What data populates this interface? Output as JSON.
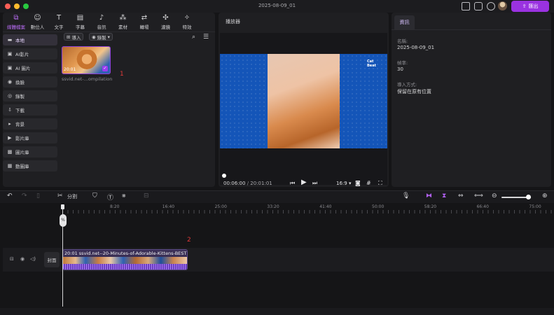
{
  "window": {
    "document_title": "2025-08-09_01",
    "export_label": "匯出"
  },
  "toolbar": {
    "tools": [
      {
        "label": "媒體檔案",
        "icon": "media-icon",
        "glyph": "⧉"
      },
      {
        "label": "數位人",
        "icon": "avatar-person-icon",
        "glyph": "☺"
      },
      {
        "label": "文字",
        "icon": "text-icon",
        "glyph": "T"
      },
      {
        "label": "字幕",
        "icon": "subtitle-icon",
        "glyph": "▤"
      },
      {
        "label": "音訊",
        "icon": "music-icon",
        "glyph": "♪"
      },
      {
        "label": "素材",
        "icon": "assets-icon",
        "glyph": "⁂"
      },
      {
        "label": "轉場",
        "icon": "transition-icon",
        "glyph": "⇄"
      },
      {
        "label": "濾鏡",
        "icon": "filter-icon",
        "glyph": "✣"
      },
      {
        "label": "特效",
        "icon": "effects-icon",
        "glyph": "✧"
      }
    ],
    "active_tool": "媒體檔案"
  },
  "media_sidebar": {
    "items": [
      {
        "label": "本地",
        "icon": "folder-icon",
        "glyph": "▬"
      },
      {
        "label": "AI影片",
        "icon": "ai-video-icon",
        "glyph": "▣"
      },
      {
        "label": "AI 圖片",
        "icon": "ai-image-icon",
        "glyph": "▣"
      },
      {
        "label": "換臉",
        "icon": "face-swap-icon",
        "glyph": "◉"
      },
      {
        "label": "錄製",
        "icon": "record-icon",
        "glyph": "◎"
      },
      {
        "label": "下載",
        "icon": "download-icon",
        "glyph": "⇩"
      },
      {
        "label": "背景",
        "icon": "background-icon",
        "glyph": "▸"
      },
      {
        "label": "影片庫",
        "icon": "video-library-icon",
        "glyph": "▶"
      },
      {
        "label": "圖片庫",
        "icon": "image-library-icon",
        "glyph": "▩"
      },
      {
        "label": "動圖庫",
        "icon": "gif-library-icon",
        "glyph": "▦"
      }
    ]
  },
  "media_actions": {
    "import_label": "導入",
    "record_label": "錄製"
  },
  "media_item": {
    "duration": "20:01",
    "name": "ssvid.net-...ompilation",
    "marker": "1"
  },
  "player": {
    "title": "播放器",
    "current_time": "00:06:00",
    "total_time": "20:01:01",
    "time_separator": "/",
    "aspect_ratio": "16:9",
    "watermark_text": "Cat Beat"
  },
  "info": {
    "tab_label": "資訊",
    "name_label": "名稱:",
    "name_value": "2025-08-09_01",
    "fps_label": "幀率:",
    "fps_value": "30",
    "import_mode_label": "導入方式:",
    "import_mode_value": "保留在原有位置"
  },
  "timeline": {
    "split_label": "分割",
    "ruler_labels": [
      "8:20",
      "16:40",
      "25:00",
      "33:20",
      "41:40",
      "50:00",
      "58:20",
      "66:40",
      "75:00"
    ],
    "playhead_badge": "%",
    "cover_label": "封面",
    "clip_label": "20:01  ssvid.net--20-Minutes-of-Adorable-Kittens-BEST",
    "clip_marker": "2",
    "zoom_level": 0.9
  },
  "colors": {
    "accent": "#9a32e0",
    "panel": "#1f1f22",
    "video_bg": "#1455b8",
    "marker": "#e23a3a"
  }
}
